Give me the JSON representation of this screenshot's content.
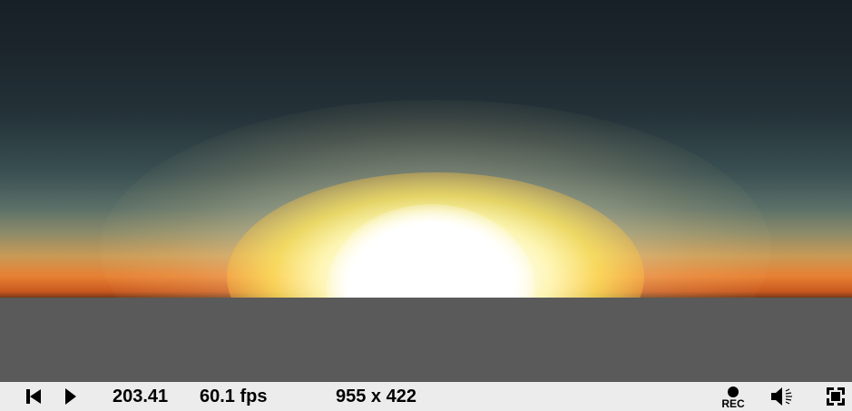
{
  "viewport": {
    "sky_colors": {
      "top": "#182027",
      "horizon": "#e77f32",
      "sun": "#ffffff",
      "ground": "#5a5a5a"
    }
  },
  "toolbar": {
    "time": "203.41",
    "fps": "60.1 fps",
    "resolution": "955 x 422",
    "rec_label": "REC",
    "icons": {
      "rewind": "skip-to-start-icon",
      "play": "play-icon",
      "record": "record-icon",
      "volume": "volume-icon",
      "fullscreen": "fullscreen-icon"
    }
  }
}
